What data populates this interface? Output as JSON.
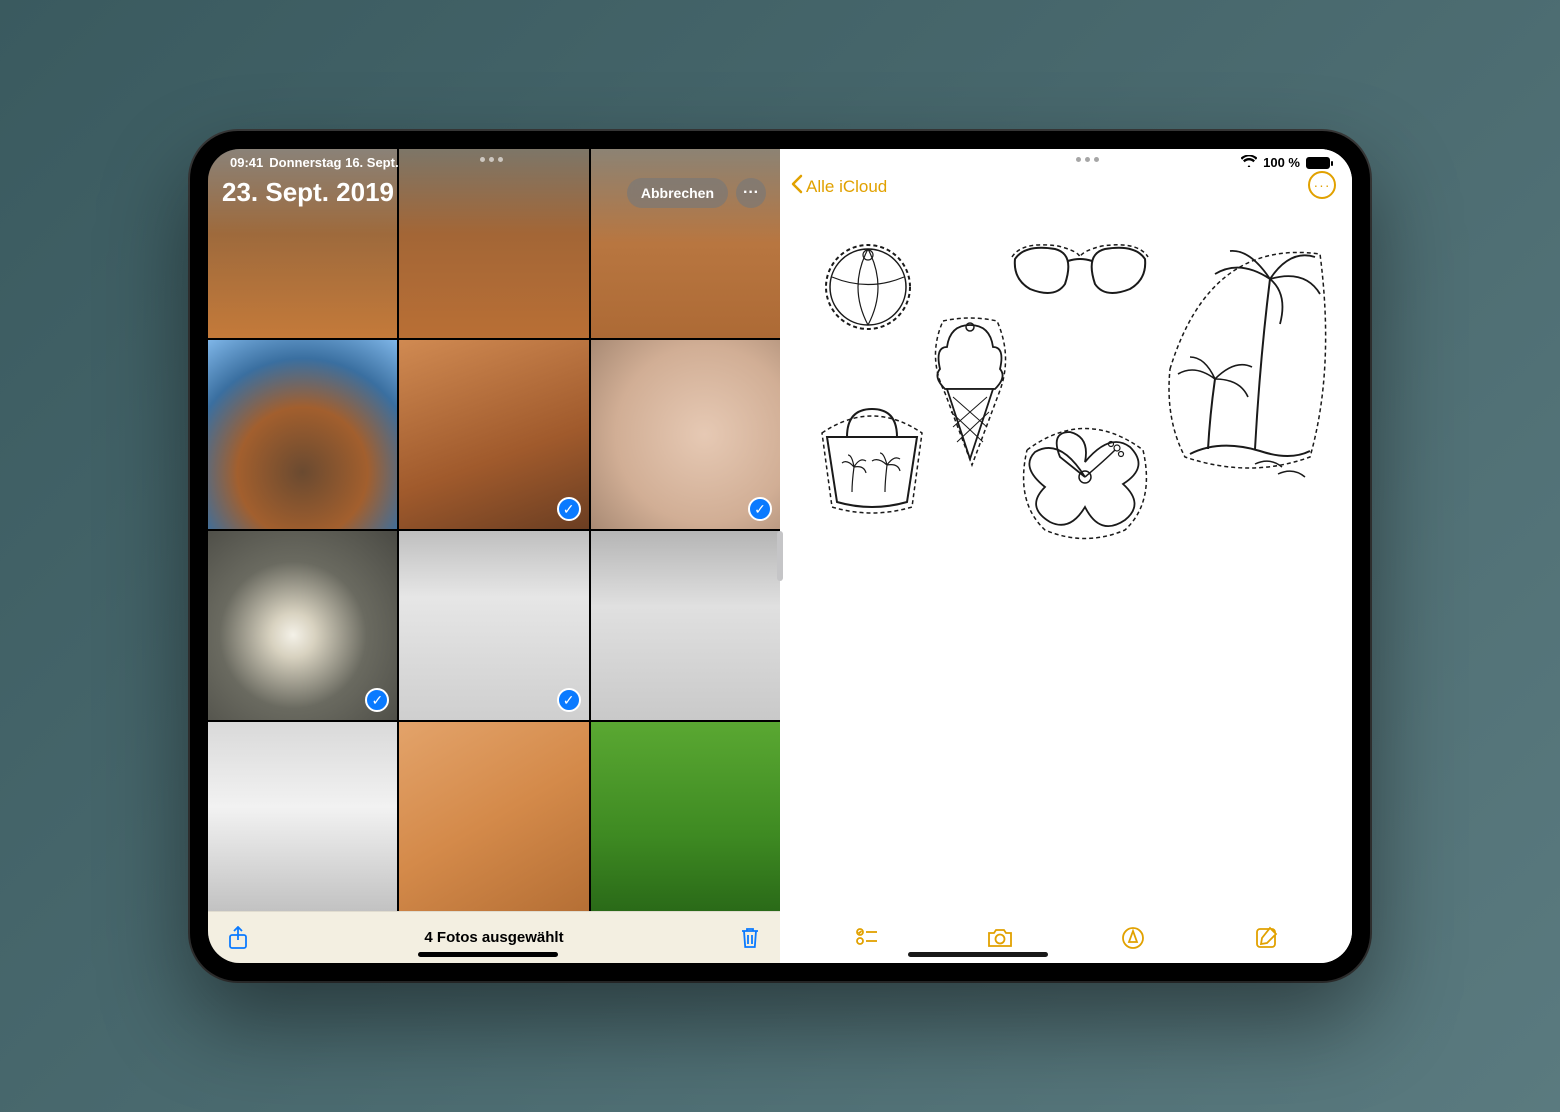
{
  "status": {
    "time": "09:41",
    "date": "Donnerstag 16. Sept.",
    "battery_text": "100 %"
  },
  "photos": {
    "header_date": "23. Sept. 2019",
    "cancel_label": "Abbrechen",
    "selected_text": "4 Fotos ausgewählt",
    "grid": [
      {
        "name": "rock-climber-1",
        "cls": "rock1",
        "selected": false
      },
      {
        "name": "rock-climber-2",
        "cls": "rock2",
        "selected": false
      },
      {
        "name": "rock-climber-3",
        "cls": "rock3",
        "selected": false
      },
      {
        "name": "desert-road",
        "cls": "road",
        "selected": false
      },
      {
        "name": "slot-canyon",
        "cls": "canyon",
        "selected": true
      },
      {
        "name": "face-closeup",
        "cls": "face",
        "selected": true
      },
      {
        "name": "white-flowers-bw",
        "cls": "flower",
        "selected": true
      },
      {
        "name": "white-dunes-1-bw",
        "cls": "dune1",
        "selected": true
      },
      {
        "name": "white-dunes-2-bw",
        "cls": "dune2",
        "selected": false
      },
      {
        "name": "lone-tree-bw",
        "cls": "tree",
        "selected": false
      },
      {
        "name": "sand-hands",
        "cls": "sand",
        "selected": false
      },
      {
        "name": "sunflowers-woman",
        "cls": "sunfl",
        "selected": false
      }
    ]
  },
  "notes": {
    "back_label": "Alle iCloud",
    "stickers": [
      "beach-ball",
      "sunglasses",
      "ice-cream-cone",
      "palm-trees",
      "beach-bag",
      "hibiscus-flower"
    ]
  },
  "colors": {
    "ios_blue": "#0a7aff",
    "notes_yellow": "#e1a100"
  }
}
